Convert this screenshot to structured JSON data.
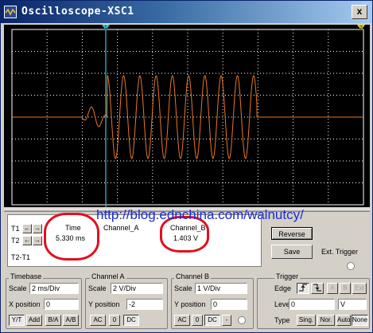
{
  "window": {
    "title": "Oscilloscope-XSC1",
    "close_glyph": "x",
    "icon": "oscilloscope-icon"
  },
  "screen": {
    "background": "#000000",
    "grid_color": "#ffffff",
    "trace_color": "#e87722",
    "cursor_color": "#30c8d8",
    "cursor_t1_label": "1",
    "cursor_t2_label": "2",
    "grid": {
      "h_divisions": 10,
      "v_divisions": 8
    }
  },
  "watermark": "http://blog.ednchina.com/walnutcy/",
  "readout": {
    "t1_label": "T1",
    "t2_label": "T2",
    "t2t1_label": "T2-T1",
    "time_header": "Time",
    "time_value": "5.330 ms",
    "channel_a_header": "Channel_A",
    "channel_a_value": "",
    "channel_b_header": "Channel_B",
    "channel_b_value": "1.403 V",
    "left_arrow": "←",
    "right_arrow": "→"
  },
  "buttons": {
    "reverse": "Reverse",
    "save": "Save",
    "ext_trigger": "Ext. Trigger"
  },
  "timebase": {
    "title": "Timebase",
    "scale_label": "Scale",
    "scale_value": "2 ms/Div",
    "xpos_label": "X position",
    "xpos_value": "0",
    "modes": [
      "Y/T",
      "Add",
      "B/A",
      "A/B"
    ],
    "selected_mode": "Y/T"
  },
  "channel_a": {
    "title": "Channel A",
    "scale_label": "Scale",
    "scale_value": "2  V/Div",
    "ypos_label": "Y position",
    "ypos_value": "-2",
    "coupling": [
      "AC",
      "0",
      "DC"
    ],
    "selected_coupling": "DC"
  },
  "channel_b": {
    "title": "Channel B",
    "scale_label": "Scale",
    "scale_value": "1  V/Div",
    "ypos_label": "Y position",
    "ypos_value": "0",
    "coupling": [
      "AC",
      "0",
      "DC",
      "-"
    ],
    "selected_coupling": "DC"
  },
  "trigger": {
    "title": "Trigger",
    "edge_label": "Edge",
    "edge_options": [
      "rising",
      "falling",
      "A",
      "B",
      "Ext"
    ],
    "level_label": "Level",
    "level_value": "0",
    "level_unit": "V",
    "type_label": "Type",
    "types": [
      "Sing.",
      "Nor.",
      "Auto",
      "None"
    ],
    "selected_type": "None"
  }
}
